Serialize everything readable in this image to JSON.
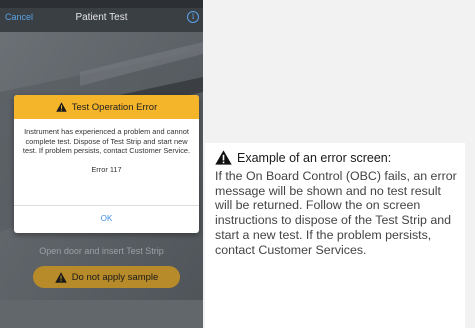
{
  "nav": {
    "cancel": "Cancel",
    "title": "Patient Test",
    "info_icon": "info-icon"
  },
  "dialog": {
    "title": "Test Operation Error",
    "body": "Instrument has experienced a problem and cannot complete test. Dispose of Test Strip and start new test. If problem persists, contact Customer Service.",
    "code": "Error 117",
    "ok": "OK"
  },
  "screen": {
    "instruction": "Open door and insert Test Strip",
    "warning": "Do not apply sample"
  },
  "callout": {
    "title": "Example of an error screen:",
    "text": "If the On Board Control (OBC) fails, an error message will be shown and no test result will be returned. Follow the on screen instructions to dispose of the Test Strip and start a new test. If the problem persists, contact Customer Services."
  },
  "colors": {
    "accent_blue": "#3d8ee0",
    "dialog_header": "#f5b52a",
    "warning_pill": "#b78a2a"
  }
}
